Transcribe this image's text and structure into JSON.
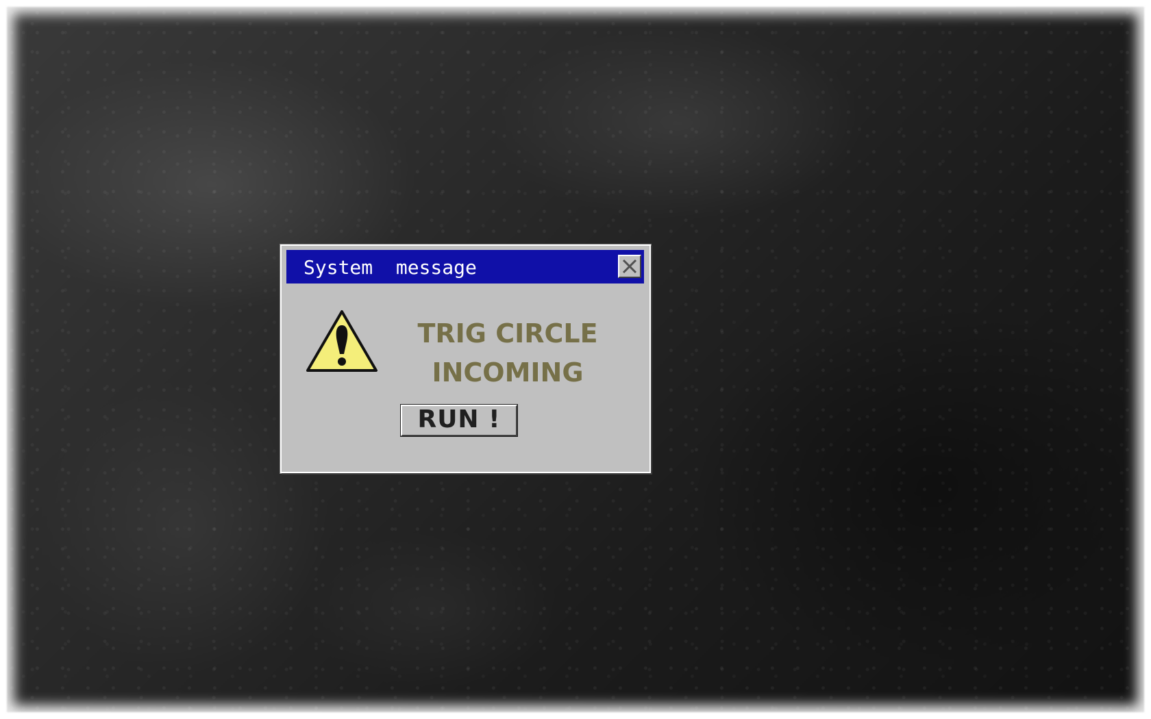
{
  "dialog": {
    "title": "System  message",
    "close_icon": "close-icon",
    "warning_icon": "warning-triangle-icon",
    "message_line1": "TRIG CIRCLE",
    "message_line2": "INCOMING",
    "button_label": "RUN !"
  },
  "colors": {
    "titlebar": "#1010a8",
    "dialog_face": "#c0c0c0",
    "message_text": "#767048",
    "warning_fill": "#f4ee7a"
  }
}
